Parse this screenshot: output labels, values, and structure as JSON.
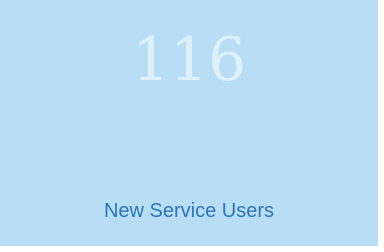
{
  "tile": {
    "value": "116",
    "label": "New Service Users",
    "background_color": "#b7def4",
    "label_color": "#2e75b6"
  }
}
